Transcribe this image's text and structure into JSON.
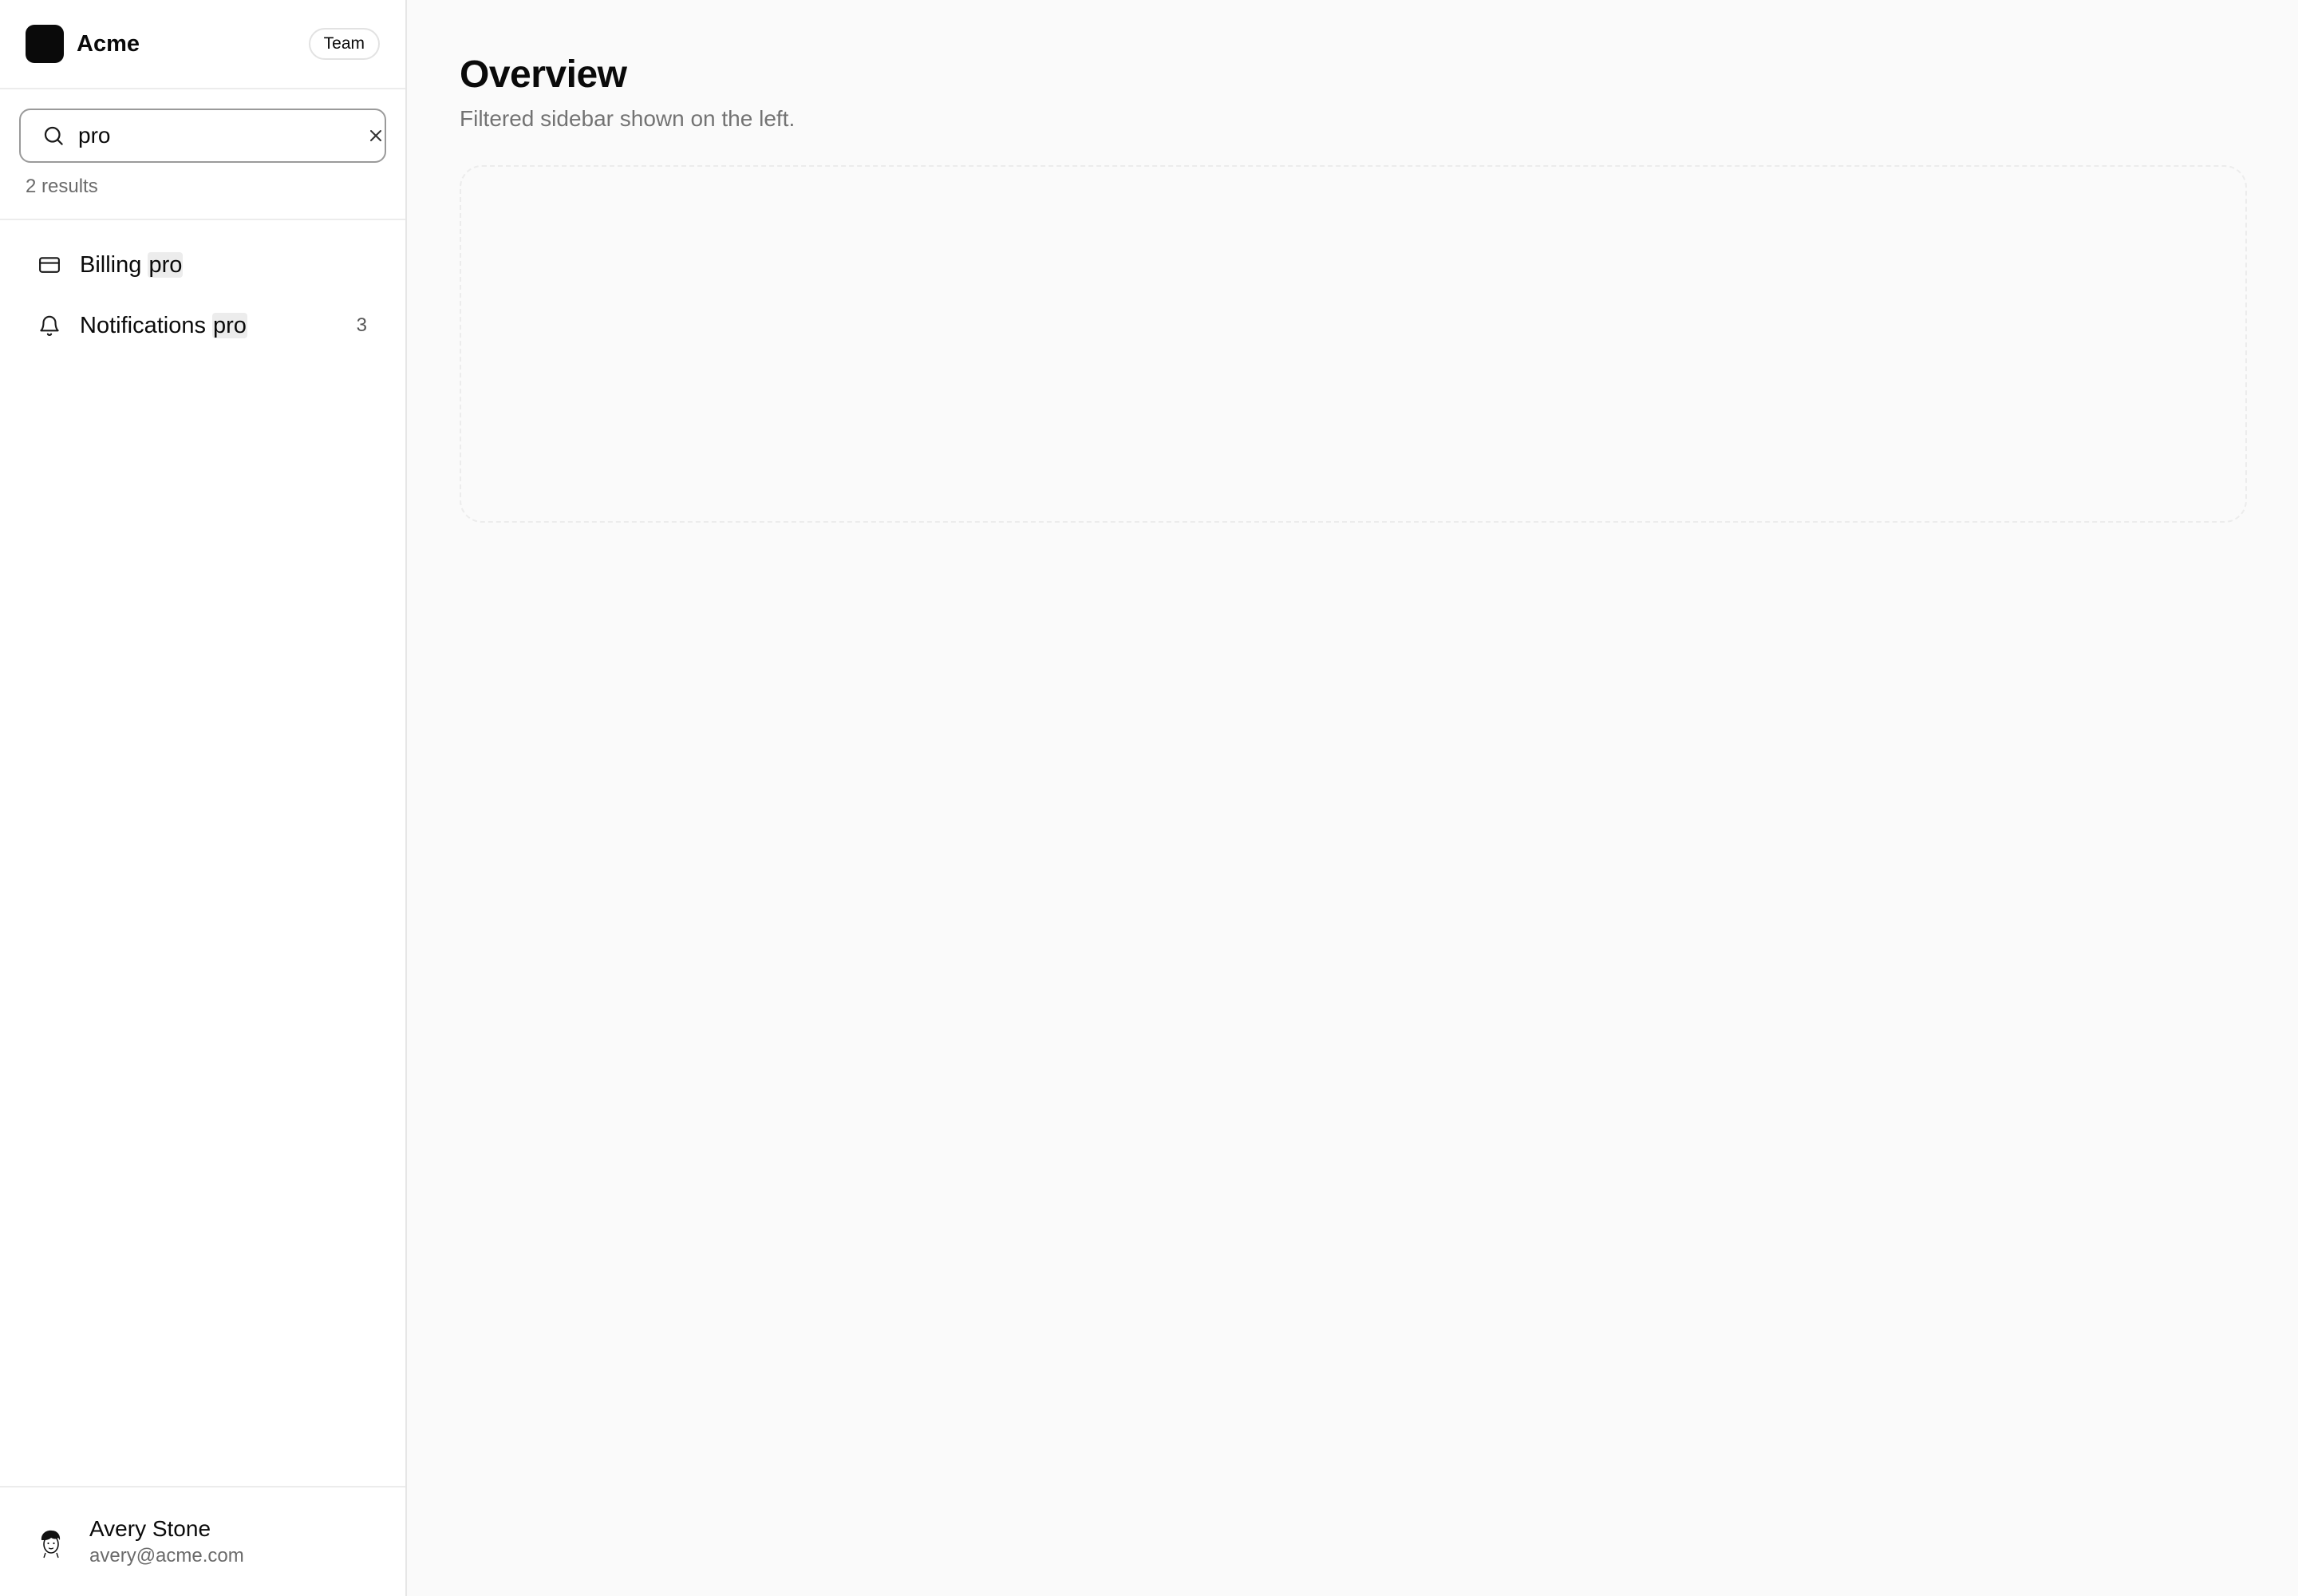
{
  "brand": {
    "name": "Acme",
    "badge": "Team"
  },
  "search": {
    "value": "pro",
    "result_count": "2 results"
  },
  "nav": {
    "items": [
      {
        "label_prefix": "Billing ",
        "label_match": "pro",
        "icon": "credit-card-icon",
        "count": ""
      },
      {
        "label_prefix": "Notifications ",
        "label_match": "pro",
        "icon": "bell-icon",
        "count": "3"
      }
    ]
  },
  "user": {
    "name": "Avery Stone",
    "email": "avery@acme.com"
  },
  "main": {
    "title": "Overview",
    "subtitle": "Filtered sidebar shown on the left."
  }
}
